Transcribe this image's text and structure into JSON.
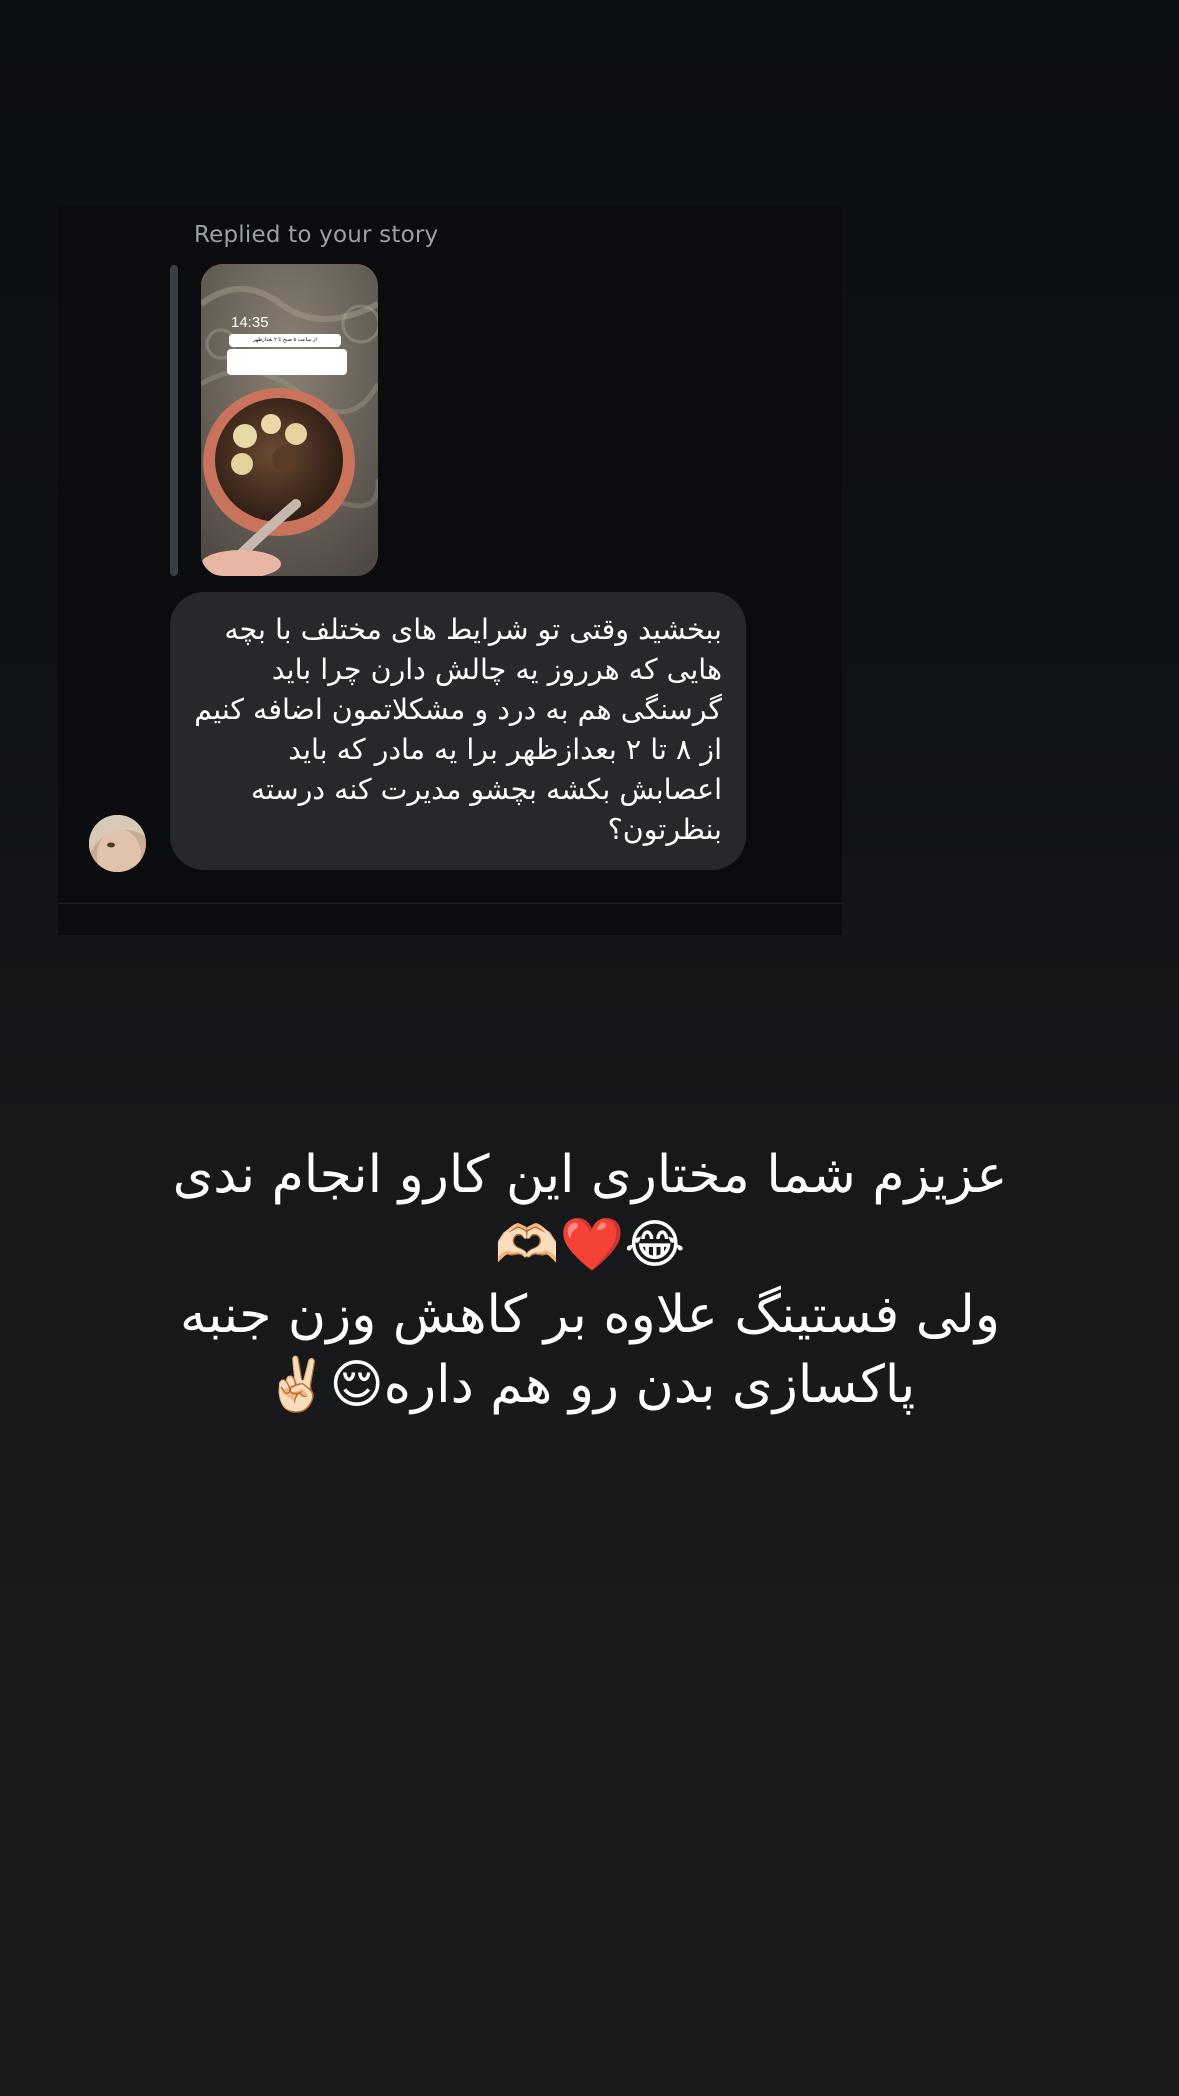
{
  "dm": {
    "replied_label": "Replied to your story",
    "story_preview": {
      "time": "14:35",
      "sticker_text": "از ساعت ۸ صبح تا ۲ بعدازظهر"
    },
    "message_text": "ببخشید وقتی تو شرایط های مختلف با بچه هایی که هرروز یه چالش دارن چرا باید گرسنگی هم به درد و مشکلاتمون اضافه کنیم از ۸ تا ۲ بعدازظهر برا یه مادر که باید اعصابش بکشه بچشو مدیرت کنه درسته بنظرتون؟"
  },
  "caption": {
    "line1": "عزیزم شما مختاری این کارو انجام ندی",
    "line2": "😂❤️🫶🏻",
    "line3": "ولی فستینگ علاوه بر کاهش وزن جنبه",
    "line4": "پاکسازی بدن رو هم داره😌✌🏻"
  },
  "colors": {
    "background_top": "#0b0e12",
    "background_bottom": "#1b1b1c",
    "bubble": "#26282c",
    "muted_text": "#9aa0a6"
  }
}
